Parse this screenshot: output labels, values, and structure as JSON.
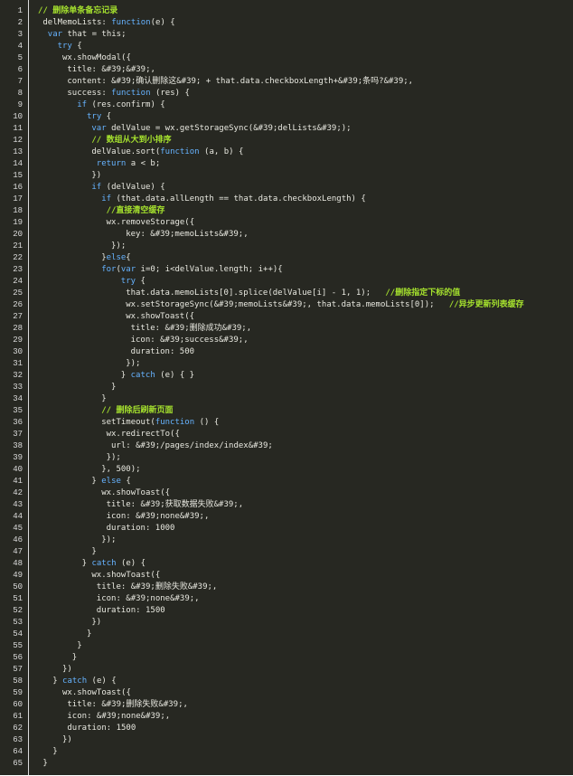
{
  "colors": {
    "background": "#272822",
    "text": "#e8e8e0",
    "keyword": "#66b3ff",
    "comment": "#a6e22e",
    "line_number": "#dcdcdc"
  },
  "lines": [
    {
      "n": "1",
      "indent": 0,
      "tokens": [
        {
          "t": "// 删除单条备忘记录",
          "c": "cm"
        }
      ]
    },
    {
      "n": "2",
      "indent": 1,
      "tokens": [
        {
          "t": "delMemoLists: ",
          "c": "txt"
        },
        {
          "t": "function",
          "c": "kw"
        },
        {
          "t": "(e) {",
          "c": "txt"
        }
      ]
    },
    {
      "n": "3",
      "indent": 2,
      "tokens": [
        {
          "t": "var",
          "c": "kw"
        },
        {
          "t": " that = this;",
          "c": "txt"
        }
      ]
    },
    {
      "n": "4",
      "indent": 4,
      "tokens": [
        {
          "t": "try",
          "c": "kw"
        },
        {
          "t": " {",
          "c": "txt"
        }
      ]
    },
    {
      "n": "5",
      "indent": 5,
      "tokens": [
        {
          "t": "wx.showModal({",
          "c": "txt"
        }
      ]
    },
    {
      "n": "6",
      "indent": 6,
      "tokens": [
        {
          "t": "title: &#39;&#39;,",
          "c": "txt"
        }
      ]
    },
    {
      "n": "7",
      "indent": 6,
      "tokens": [
        {
          "t": "content: &#39;确认删除这&#39; + that.data.checkboxLength+&#39;条吗?&#39;,",
          "c": "txt"
        }
      ]
    },
    {
      "n": "8",
      "indent": 6,
      "tokens": [
        {
          "t": "success: ",
          "c": "txt"
        },
        {
          "t": "function",
          "c": "kw"
        },
        {
          "t": " (res) {",
          "c": "txt"
        }
      ]
    },
    {
      "n": "9",
      "indent": 8,
      "tokens": [
        {
          "t": "if",
          "c": "kw"
        },
        {
          "t": " (res.confirm) {",
          "c": "txt"
        }
      ]
    },
    {
      "n": "10",
      "indent": 10,
      "tokens": [
        {
          "t": "try",
          "c": "kw"
        },
        {
          "t": " {",
          "c": "txt"
        }
      ]
    },
    {
      "n": "11",
      "indent": 11,
      "tokens": [
        {
          "t": "var",
          "c": "kw"
        },
        {
          "t": " delValue = wx.getStorageSync(&#39;delLists&#39;);",
          "c": "txt"
        }
      ]
    },
    {
      "n": "12",
      "indent": 11,
      "tokens": [
        {
          "t": "// 数组从大到小排序",
          "c": "cm"
        }
      ]
    },
    {
      "n": "13",
      "indent": 11,
      "tokens": [
        {
          "t": "delValue.sort(",
          "c": "txt"
        },
        {
          "t": "function",
          "c": "kw"
        },
        {
          "t": " (a, b) {",
          "c": "txt"
        }
      ]
    },
    {
      "n": "14",
      "indent": 12,
      "tokens": [
        {
          "t": "return",
          "c": "kw"
        },
        {
          "t": " a < b;",
          "c": "txt"
        }
      ]
    },
    {
      "n": "15",
      "indent": 11,
      "tokens": [
        {
          "t": "})",
          "c": "txt"
        }
      ]
    },
    {
      "n": "16",
      "indent": 11,
      "tokens": [
        {
          "t": "if",
          "c": "kw"
        },
        {
          "t": " (delValue) {",
          "c": "txt"
        }
      ]
    },
    {
      "n": "17",
      "indent": 13,
      "tokens": [
        {
          "t": "if",
          "c": "kw"
        },
        {
          "t": " (that.data.allLength == that.data.checkboxLength) {",
          "c": "txt"
        }
      ]
    },
    {
      "n": "18",
      "indent": 14,
      "tokens": [
        {
          "t": "//直接清空缓存",
          "c": "cm"
        }
      ]
    },
    {
      "n": "19",
      "indent": 14,
      "tokens": [
        {
          "t": "wx.removeStorage({",
          "c": "txt"
        }
      ]
    },
    {
      "n": "20",
      "indent": 18,
      "tokens": [
        {
          "t": "key: &#39;memoLists&#39;,",
          "c": "txt"
        }
      ]
    },
    {
      "n": "21",
      "indent": 14,
      "tokens": [
        {
          "t": " });",
          "c": "txt"
        }
      ]
    },
    {
      "n": "22",
      "indent": 13,
      "tokens": [
        {
          "t": "}",
          "c": "txt"
        },
        {
          "t": "else",
          "c": "kw"
        },
        {
          "t": "{",
          "c": "txt"
        }
      ]
    },
    {
      "n": "23",
      "indent": 13,
      "tokens": [
        {
          "t": "for",
          "c": "kw"
        },
        {
          "t": "(",
          "c": "txt"
        },
        {
          "t": "var",
          "c": "kw"
        },
        {
          "t": " i=0; i<delValue.length; i++){",
          "c": "txt"
        }
      ]
    },
    {
      "n": "24",
      "indent": 17,
      "tokens": [
        {
          "t": "try",
          "c": "kw"
        },
        {
          "t": " {",
          "c": "txt"
        }
      ]
    },
    {
      "n": "25",
      "indent": 18,
      "tokens": [
        {
          "t": "that.data.memoLists[0].splice(delValue[i] - 1, 1);   ",
          "c": "txt"
        },
        {
          "t": "//删除指定下标的值",
          "c": "cm"
        }
      ]
    },
    {
      "n": "26",
      "indent": 18,
      "tokens": [
        {
          "t": "wx.setStorageSync(&#39;memoLists&#39;, that.data.memoLists[0]);   ",
          "c": "txt"
        },
        {
          "t": "//异步更新列表缓存",
          "c": "cm"
        }
      ]
    },
    {
      "n": "27",
      "indent": 18,
      "tokens": [
        {
          "t": "wx.showToast({",
          "c": "txt"
        }
      ]
    },
    {
      "n": "28",
      "indent": 19,
      "tokens": [
        {
          "t": "title: &#39;删除成功&#39;,",
          "c": "txt"
        }
      ]
    },
    {
      "n": "29",
      "indent": 19,
      "tokens": [
        {
          "t": "icon: &#39;success&#39;,",
          "c": "txt"
        }
      ]
    },
    {
      "n": "30",
      "indent": 19,
      "tokens": [
        {
          "t": "duration: 500",
          "c": "txt"
        }
      ]
    },
    {
      "n": "31",
      "indent": 18,
      "tokens": [
        {
          "t": "});",
          "c": "txt"
        }
      ]
    },
    {
      "n": "32",
      "indent": 17,
      "tokens": [
        {
          "t": "} ",
          "c": "txt"
        },
        {
          "t": "catch",
          "c": "kw"
        },
        {
          "t": " (e) { }",
          "c": "txt"
        }
      ]
    },
    {
      "n": "33",
      "indent": 15,
      "tokens": [
        {
          "t": "}",
          "c": "txt"
        }
      ]
    },
    {
      "n": "34",
      "indent": 13,
      "tokens": [
        {
          "t": "}",
          "c": "txt"
        }
      ]
    },
    {
      "n": "35",
      "indent": 13,
      "tokens": [
        {
          "t": "// 删除后刷新页面",
          "c": "cm"
        }
      ]
    },
    {
      "n": "36",
      "indent": 13,
      "tokens": [
        {
          "t": "setTimeout(",
          "c": "txt"
        },
        {
          "t": "function",
          "c": "kw"
        },
        {
          "t": " () {",
          "c": "txt"
        }
      ]
    },
    {
      "n": "37",
      "indent": 14,
      "tokens": [
        {
          "t": "wx.redirectTo({",
          "c": "txt"
        }
      ]
    },
    {
      "n": "38",
      "indent": 15,
      "tokens": [
        {
          "t": "url: &#39;/pages/index/index&#39;",
          "c": "txt"
        }
      ]
    },
    {
      "n": "39",
      "indent": 14,
      "tokens": [
        {
          "t": "});",
          "c": "txt"
        }
      ]
    },
    {
      "n": "40",
      "indent": 13,
      "tokens": [
        {
          "t": "}, 500);",
          "c": "txt"
        }
      ]
    },
    {
      "n": "41",
      "indent": 11,
      "tokens": [
        {
          "t": "} ",
          "c": "txt"
        },
        {
          "t": "else",
          "c": "kw"
        },
        {
          "t": " {",
          "c": "txt"
        }
      ]
    },
    {
      "n": "42",
      "indent": 13,
      "tokens": [
        {
          "t": "wx.showToast({",
          "c": "txt"
        }
      ]
    },
    {
      "n": "43",
      "indent": 14,
      "tokens": [
        {
          "t": "title: &#39;获取数据失败&#39;,",
          "c": "txt"
        }
      ]
    },
    {
      "n": "44",
      "indent": 14,
      "tokens": [
        {
          "t": "icon: &#39;none&#39;,",
          "c": "txt"
        }
      ]
    },
    {
      "n": "45",
      "indent": 14,
      "tokens": [
        {
          "t": "duration: 1000",
          "c": "txt"
        }
      ]
    },
    {
      "n": "46",
      "indent": 13,
      "tokens": [
        {
          "t": "});",
          "c": "txt"
        }
      ]
    },
    {
      "n": "47",
      "indent": 11,
      "tokens": [
        {
          "t": "}",
          "c": "txt"
        }
      ]
    },
    {
      "n": "48",
      "indent": 9,
      "tokens": [
        {
          "t": "} ",
          "c": "txt"
        },
        {
          "t": "catch",
          "c": "kw"
        },
        {
          "t": " (e) {",
          "c": "txt"
        }
      ]
    },
    {
      "n": "49",
      "indent": 11,
      "tokens": [
        {
          "t": "wx.showToast({",
          "c": "txt"
        }
      ]
    },
    {
      "n": "50",
      "indent": 12,
      "tokens": [
        {
          "t": "title: &#39;删除失败&#39;,",
          "c": "txt"
        }
      ]
    },
    {
      "n": "51",
      "indent": 12,
      "tokens": [
        {
          "t": "icon: &#39;none&#39;,",
          "c": "txt"
        }
      ]
    },
    {
      "n": "52",
      "indent": 12,
      "tokens": [
        {
          "t": "duration: 1500",
          "c": "txt"
        }
      ]
    },
    {
      "n": "53",
      "indent": 11,
      "tokens": [
        {
          "t": "})",
          "c": "txt"
        }
      ]
    },
    {
      "n": "54",
      "indent": 10,
      "tokens": [
        {
          "t": "}",
          "c": "txt"
        }
      ]
    },
    {
      "n": "55",
      "indent": 8,
      "tokens": [
        {
          "t": "}",
          "c": "txt"
        }
      ]
    },
    {
      "n": "56",
      "indent": 7,
      "tokens": [
        {
          "t": "}",
          "c": "txt"
        }
      ]
    },
    {
      "n": "57",
      "indent": 5,
      "tokens": [
        {
          "t": "})",
          "c": "txt"
        }
      ]
    },
    {
      "n": "58",
      "indent": 3,
      "tokens": [
        {
          "t": "} ",
          "c": "txt"
        },
        {
          "t": "catch",
          "c": "kw"
        },
        {
          "t": " (e) {",
          "c": "txt"
        }
      ]
    },
    {
      "n": "59",
      "indent": 5,
      "tokens": [
        {
          "t": "wx.showToast({",
          "c": "txt"
        }
      ]
    },
    {
      "n": "60",
      "indent": 6,
      "tokens": [
        {
          "t": "title: &#39;删除失败&#39;,",
          "c": "txt"
        }
      ]
    },
    {
      "n": "61",
      "indent": 6,
      "tokens": [
        {
          "t": "icon: &#39;none&#39;,",
          "c": "txt"
        }
      ]
    },
    {
      "n": "62",
      "indent": 6,
      "tokens": [
        {
          "t": "duration: 1500",
          "c": "txt"
        }
      ]
    },
    {
      "n": "63",
      "indent": 5,
      "tokens": [
        {
          "t": "})",
          "c": "txt"
        }
      ]
    },
    {
      "n": "64",
      "indent": 3,
      "tokens": [
        {
          "t": "}",
          "c": "txt"
        }
      ]
    },
    {
      "n": "65",
      "indent": 1,
      "tokens": [
        {
          "t": "}",
          "c": "txt"
        }
      ]
    }
  ]
}
